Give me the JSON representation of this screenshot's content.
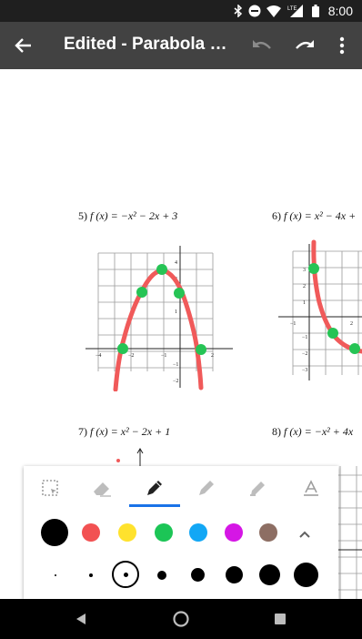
{
  "status_bar": {
    "time": "8:00",
    "network": "LTE"
  },
  "app_bar": {
    "title": "Edited - Parabola Gr..."
  },
  "document": {
    "problems": [
      {
        "number": "5)",
        "function": "f (x) = −x² − 2x + 3"
      },
      {
        "number": "6)",
        "function": "f (x) = x² − 4x +"
      },
      {
        "number": "7)",
        "function": "f (x) = x² − 2x + 1"
      },
      {
        "number": "8)",
        "function": "f (x) = −x² + 4x"
      }
    ],
    "graph5": {
      "x_ticks": [
        "−4",
        "−2",
        "−1",
        "2"
      ],
      "y_ticks": [
        "4",
        "3",
        "2",
        "1",
        "−1",
        "−2"
      ],
      "marked_points": [
        [
          -3,
          0
        ],
        [
          -2,
          3
        ],
        [
          -1,
          4
        ],
        [
          0,
          3
        ],
        [
          1,
          0
        ]
      ]
    },
    "graph6": {
      "x_ticks": [
        "−1",
        "2"
      ],
      "y_ticks": [
        "3",
        "2",
        "1",
        "−1",
        "−2",
        "−3"
      ]
    }
  },
  "palette": {
    "tools": [
      "select-area",
      "eraser",
      "pen",
      "marker",
      "highlighter",
      "text"
    ],
    "selected_tool": "pen",
    "colors": [
      "#000000",
      "#f25152",
      "#ffe22d",
      "#1cc556",
      "#12a7f5",
      "#d516e5",
      "#8d6e63"
    ],
    "selected_color": "#000000",
    "sizes_count": 8,
    "selected_size_index": 2
  },
  "ink": {
    "color": "#f05a5a",
    "points_color": "#26c455"
  }
}
